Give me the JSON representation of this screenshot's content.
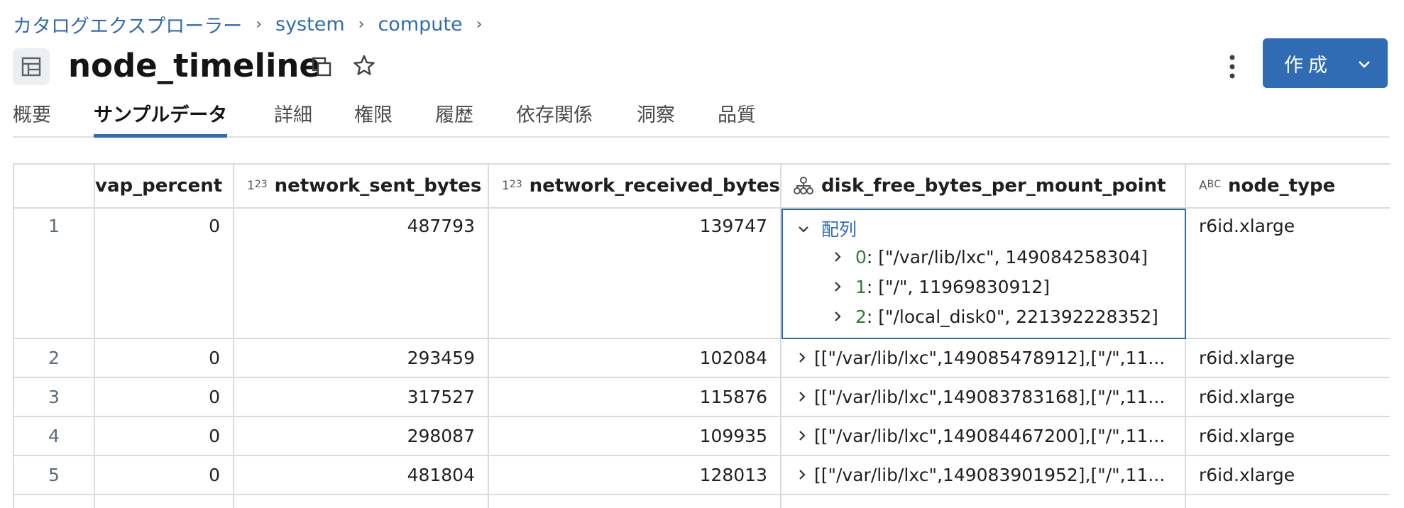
{
  "breadcrumb": {
    "items": [
      "カタログエクスプローラー",
      "system",
      "compute"
    ],
    "separator": "›"
  },
  "header": {
    "title": "node_timeline",
    "create_label": "作成"
  },
  "tabs": [
    "概要",
    "サンプルデータ",
    "詳細",
    "権限",
    "履歴",
    "依存関係",
    "洞察",
    "品質"
  ],
  "active_tab": "サンプルデータ",
  "table": {
    "columns": [
      {
        "name": "vap_percent",
        "type_icon": ""
      },
      {
        "name": "network_sent_bytes",
        "type_icon": "123"
      },
      {
        "name": "network_received_bytes",
        "type_icon": "123"
      },
      {
        "name": "disk_free_bytes_per_mount_point",
        "type_icon": "struct"
      },
      {
        "name": "node_type",
        "type_icon": "ABC"
      }
    ],
    "rows": [
      {
        "num": "1",
        "vap": "0",
        "sent": "487793",
        "recv": "139747",
        "node_type": "r6id.xlarge"
      },
      {
        "num": "2",
        "vap": "0",
        "sent": "293459",
        "recv": "102084",
        "disk": "[[\"/var/lib/lxc\",149085478912],[\"/\",11...",
        "node_type": "r6id.xlarge"
      },
      {
        "num": "3",
        "vap": "0",
        "sent": "317527",
        "recv": "115876",
        "disk": "[[\"/var/lib/lxc\",149083783168],[\"/\",11...",
        "node_type": "r6id.xlarge"
      },
      {
        "num": "4",
        "vap": "0",
        "sent": "298087",
        "recv": "109935",
        "disk": "[[\"/var/lib/lxc\",149084467200],[\"/\",11...",
        "node_type": "r6id.xlarge"
      },
      {
        "num": "5",
        "vap": "0",
        "sent": "481804",
        "recv": "128013",
        "disk": "[[\"/var/lib/lxc\",149083901952],[\"/\",11...",
        "node_type": "r6id.xlarge"
      }
    ],
    "expanded": {
      "label": "配列",
      "items": [
        {
          "index": "0",
          "value": ": [\"/var/lib/lxc\", 149084258304]"
        },
        {
          "index": "1",
          "value": ": [\"/\", 11969830912]"
        },
        {
          "index": "2",
          "value": ": [\"/local_disk0\", 221392228352]"
        }
      ]
    }
  },
  "colors": {
    "accent": "#2f6cb3",
    "index_green": "#2e7d32",
    "border": "#d8dce1"
  }
}
